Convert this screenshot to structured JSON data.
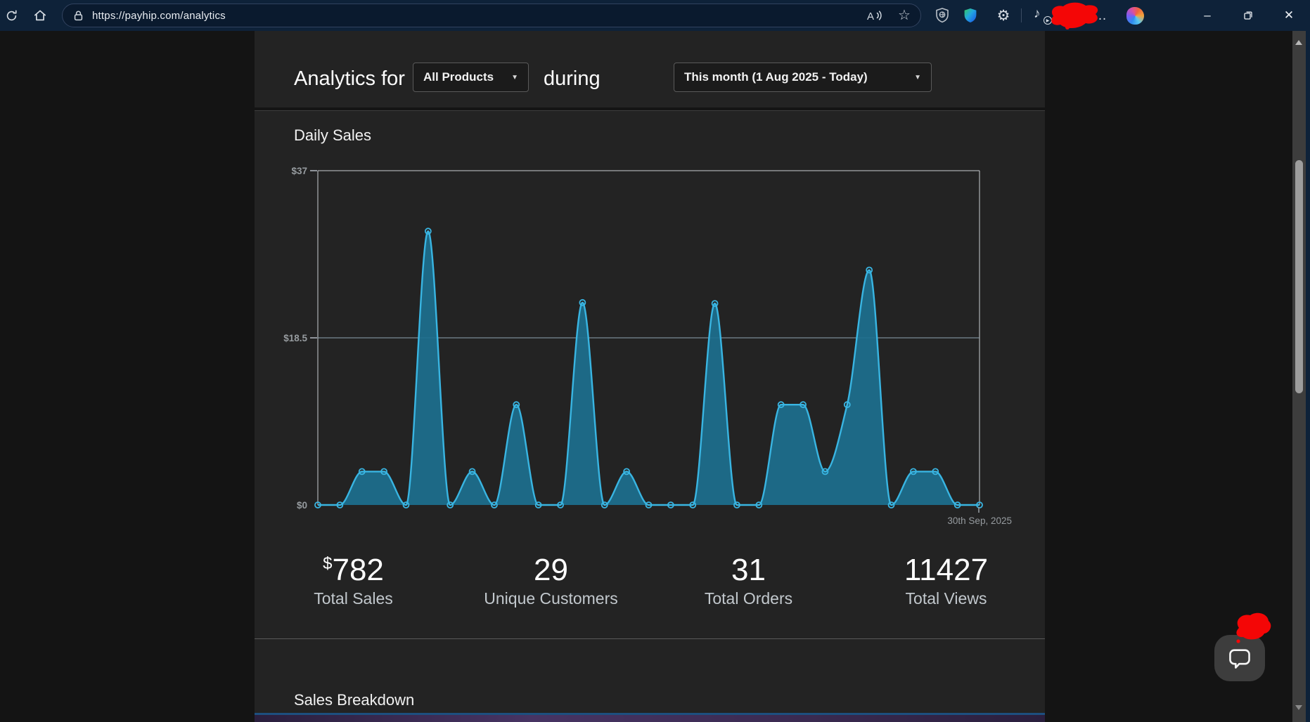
{
  "browser": {
    "url": "https://payhip.com/analytics",
    "glyphs": {
      "star": "☆",
      "gear": "⚙",
      "note": "♪",
      "play": "▶",
      "ellipsis": "…",
      "minimize": "–",
      "close": "✕",
      "caret": "▼"
    }
  },
  "page": {
    "filter_bar": {
      "prefix_label": "Analytics for",
      "product_dropdown_value": "All Products",
      "middle_label": "during",
      "date_dropdown_value": "This month (1 Aug 2025 - Today)"
    },
    "stats": [
      {
        "prefix": "$",
        "value": "782",
        "label": "Total Sales"
      },
      {
        "value": "29",
        "label": "Unique Customers"
      },
      {
        "value": "31",
        "label": "Total Orders"
      },
      {
        "value": "11427",
        "label": "Total Views"
      }
    ],
    "sales_breakdown_title": "Sales Breakdown"
  },
  "chart_data": {
    "type": "area",
    "title": "Daily Sales",
    "values": [
      0,
      0,
      3.7,
      3.7,
      0,
      30.3,
      0,
      3.7,
      0,
      11.1,
      0,
      0,
      22.4,
      0,
      3.7,
      0,
      0,
      0,
      22.3,
      0,
      0,
      11.1,
      11.1,
      3.7,
      11.1,
      26,
      0,
      3.7,
      3.7,
      0,
      0
    ],
    "x_points": 31,
    "ylim": [
      0,
      37
    ],
    "yticks": [
      {
        "label": "$37",
        "value": 37
      },
      {
        "label": "$18.5",
        "value": 18.5
      },
      {
        "label": "$0",
        "value": 0
      }
    ],
    "x_end_label": "30th Sep, 2025",
    "grid": "horizontal gridline at mid value only",
    "line_color": "#39b5e2",
    "fill_color": "#1d6f8e",
    "axis_color": "#c8cdd2",
    "grid_color": "#8fa6b2",
    "tick_color": "#969b9f"
  }
}
